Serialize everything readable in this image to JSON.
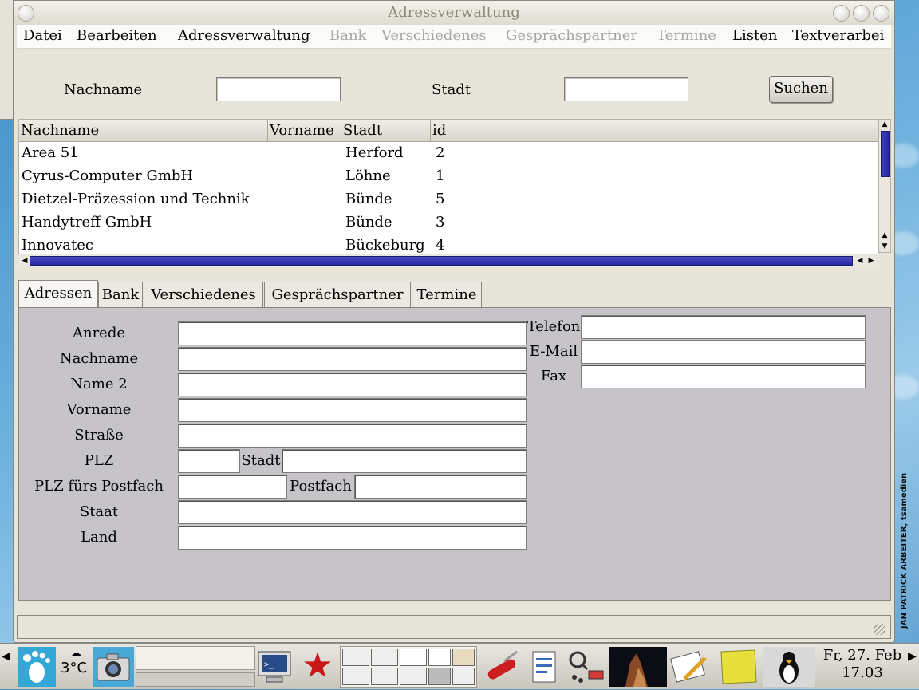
{
  "window": {
    "title": "Adressverwaltung"
  },
  "menu": [
    {
      "label": "Datei",
      "disabled": false
    },
    {
      "label": "Bearbeiten",
      "disabled": false
    },
    {
      "label": "Adressverwaltung",
      "disabled": false
    },
    {
      "label": "Bank",
      "disabled": true
    },
    {
      "label": "Verschiedenes",
      "disabled": true
    },
    {
      "label": "Gesprächspartner",
      "disabled": true
    },
    {
      "label": "Termine",
      "disabled": true
    },
    {
      "label": "Listen",
      "disabled": false
    },
    {
      "label": "Textverarbei",
      "disabled": false
    }
  ],
  "search": {
    "nachname_label": "Nachname",
    "nachname_value": "",
    "stadt_label": "Stadt",
    "stadt_value": "",
    "button_label": "Suchen"
  },
  "list": {
    "columns": [
      "Nachname",
      "Vorname",
      "Stadt",
      "id"
    ],
    "rows": [
      {
        "nachname": "Area 51",
        "vorname": "",
        "stadt": "Herford",
        "id": "2"
      },
      {
        "nachname": "Cyrus-Computer GmbH",
        "vorname": "",
        "stadt": "Löhne",
        "id": "1"
      },
      {
        "nachname": "Dietzel-Präzession und Technik",
        "vorname": "",
        "stadt": "Bünde",
        "id": "5"
      },
      {
        "nachname": "Handytreff GmbH",
        "vorname": "",
        "stadt": "Bünde",
        "id": "3"
      },
      {
        "nachname": "Innovatec",
        "vorname": "",
        "stadt": "Bückeburg",
        "id": "4"
      }
    ]
  },
  "tabs": [
    "Adressen",
    "Bank",
    "Verschiedenes",
    "Gesprächspartner",
    "Termine"
  ],
  "form": {
    "anrede": "Anrede",
    "nachname": "Nachname",
    "name2": "Name 2",
    "vorname": "Vorname",
    "strasse": "Straße",
    "plz": "PLZ",
    "stadt": "Stadt",
    "plz_postfach": "PLZ fürs Postfach",
    "postfach": "Postfach",
    "staat": "Staat",
    "land": "Land",
    "telefon": "Telefon",
    "email": "E-Mail",
    "fax": "Fax"
  },
  "taskbar": {
    "temperature": "3°C",
    "clock_date": "Fr, 27. Feb",
    "clock_time": "17.03"
  },
  "credit": "JAN PATRICK ARBEITER, tsamedien",
  "colors": {
    "scroll_thumb": "#2a2aa6",
    "tab_panel": "#c6c4c9",
    "window_bg": "#e7e4d9"
  }
}
